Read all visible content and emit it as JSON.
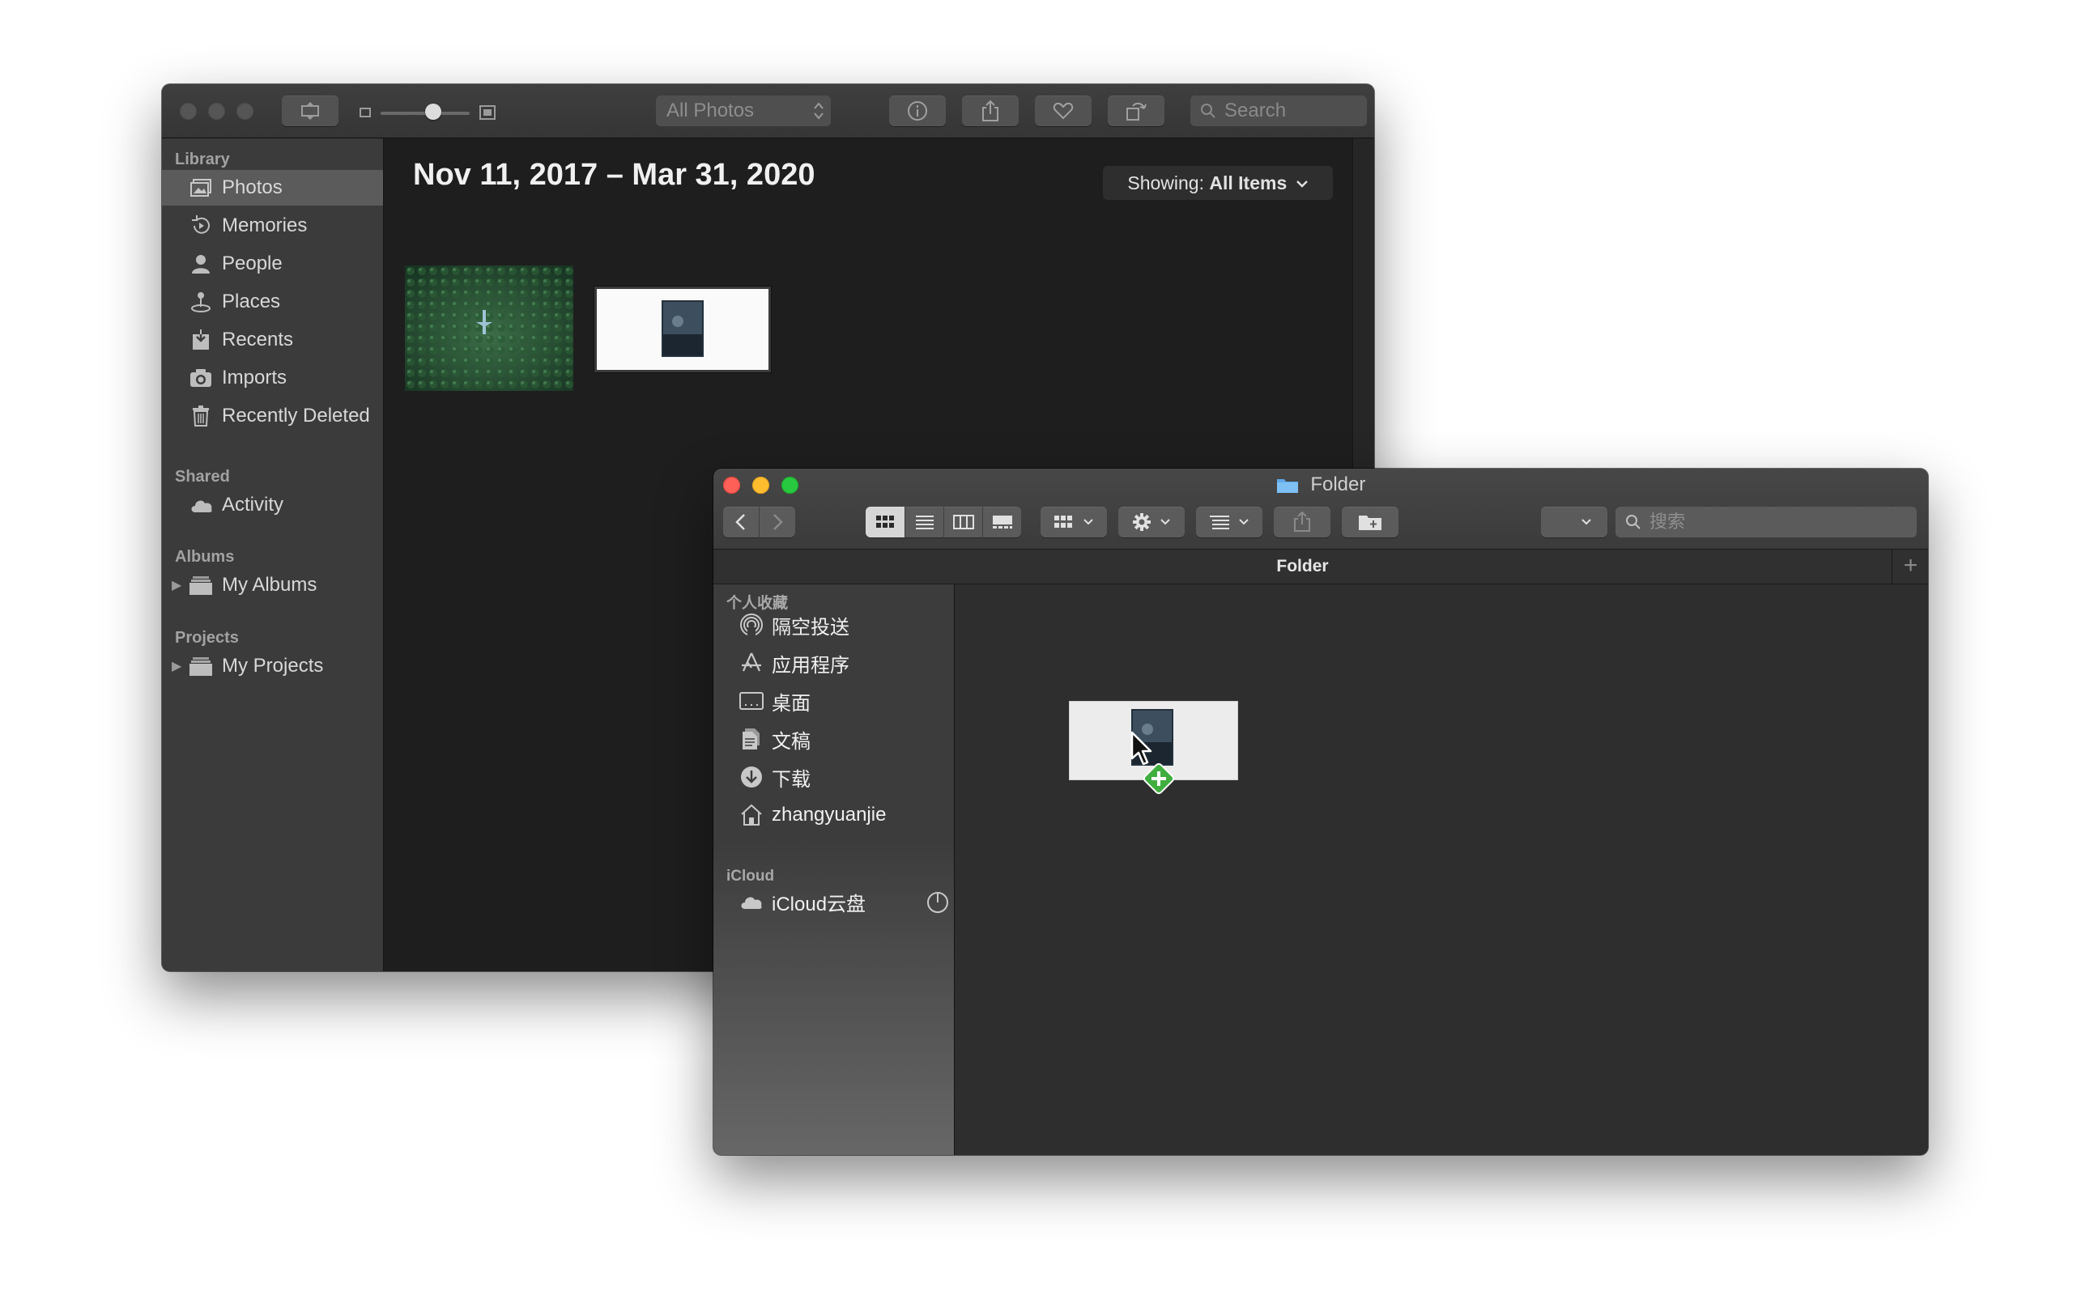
{
  "photos_window": {
    "toolbar": {
      "view_popup": "All Photos",
      "search_placeholder": "Search",
      "buttons": [
        "slideshow-button",
        "info-button",
        "share-button",
        "favorite-button",
        "rotate-button"
      ]
    },
    "sidebar": {
      "sections": [
        {
          "heading": "Library",
          "items": [
            {
              "label": "Photos",
              "icon": "photos-icon",
              "selected": true
            },
            {
              "label": "Memories",
              "icon": "memories-icon"
            },
            {
              "label": "People",
              "icon": "people-icon"
            },
            {
              "label": "Places",
              "icon": "places-icon"
            },
            {
              "label": "Recents",
              "icon": "recents-icon"
            },
            {
              "label": "Imports",
              "icon": "imports-icon"
            },
            {
              "label": "Recently Deleted",
              "icon": "trash-icon"
            }
          ]
        },
        {
          "heading": "Shared",
          "items": [
            {
              "label": "Activity",
              "icon": "cloud-icon"
            }
          ]
        },
        {
          "heading": "Albums",
          "items": [
            {
              "label": "My Albums",
              "icon": "folder-icon",
              "disclosure": true
            }
          ]
        },
        {
          "heading": "Projects",
          "items": [
            {
              "label": "My Projects",
              "icon": "folder-icon",
              "disclosure": true
            }
          ]
        }
      ]
    },
    "content": {
      "date_range": "Nov 11, 2017 – Mar 31, 2020",
      "showing_prefix": "Showing:",
      "showing_value": "All Items"
    }
  },
  "finder_window": {
    "title": "Folder",
    "tab_label": "Folder",
    "search_placeholder": "搜索",
    "sidebar": {
      "favorites_heading": "个人收藏",
      "favorites": [
        {
          "label": "隔空投送",
          "icon": "airdrop-icon"
        },
        {
          "label": "应用程序",
          "icon": "applications-icon"
        },
        {
          "label": "桌面",
          "icon": "desktop-icon"
        },
        {
          "label": "文稿",
          "icon": "documents-icon"
        },
        {
          "label": "下载",
          "icon": "downloads-icon"
        },
        {
          "label": "zhangyuanjie",
          "icon": "home-icon"
        }
      ],
      "icloud_heading": "iCloud",
      "icloud": [
        {
          "label": "iCloud云盘",
          "icon": "icloud-icon"
        }
      ]
    }
  },
  "colors": {
    "close": "#fe5f57",
    "minimize": "#febc2e",
    "zoom": "#28c840",
    "copy_badge": "#3fae3f",
    "folder_blue": "#5fa9e6"
  }
}
